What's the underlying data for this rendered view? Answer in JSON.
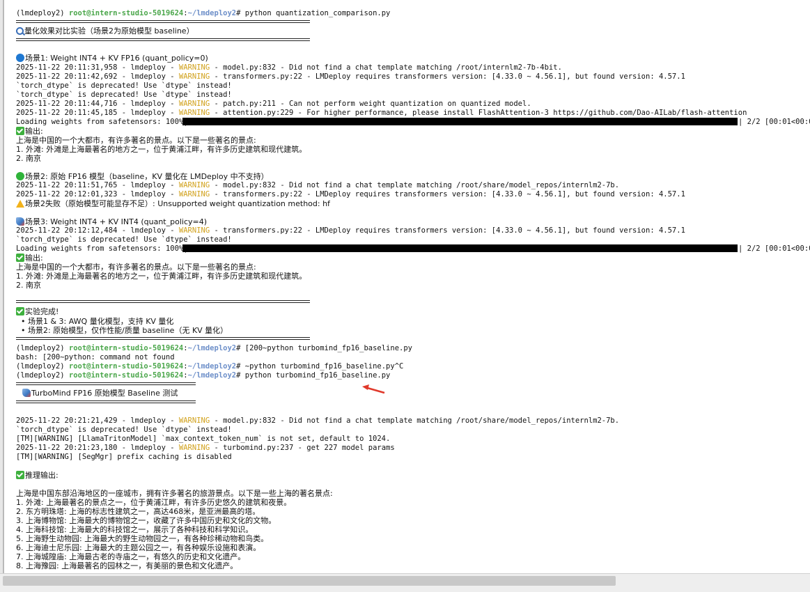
{
  "prompt": {
    "env": "(lmdeploy2)",
    "user": "root@intern-studio-5019624",
    "path": "~/lmdeploy2"
  },
  "lines": {
    "cmd1": "# python quantization_comparison.py",
    "title1": "量化效果对比实验（场景2为原始模型 baseline）",
    "s1_head": "场景1: Weight INT4 + KV FP16 (quant_policy=0)",
    "l1_pre": "2025-11-22 20:11:31,958 - lmdeploy - ",
    "l1_post": " - model.py:832 - Did not find a chat template matching /root/internlm2-7b-4bit.",
    "l2_pre": "2025-11-22 20:11:42,692 - lmdeploy - ",
    "l2_post": " - transformers.py:22 - LMDeploy requires transformers version: [4.33.0 ~ 4.56.1], but found version: 4.57.1",
    "l3": "`torch_dtype` is deprecated! Use `dtype` instead!",
    "l4": "`torch_dtype` is deprecated! Use `dtype` instead!",
    "l5_pre": "2025-11-22 20:11:44,716 - lmdeploy - ",
    "l5_post": " - patch.py:211 - Can not perform weight quantization on quantized model.",
    "l6_pre": "2025-11-22 20:11:45,185 - lmdeploy - ",
    "l6_post": " - attention.py:229 - For higher performance, please install FlashAttention-3 https://github.com/Dao-AILab/flash-attention",
    "load1": "Loading weights from safetensors: 100%|",
    "load1_tail": "| 2/2 [00:01<00:00,",
    "out1_label": "输出:",
    "out1_a": "上海是中国的一个大都市，有许多著名的景点。以下是一些著名的景点:",
    "out1_b": "1. 外滩: 外滩是上海最著名的地方之一，位于黄浦江畔，有许多历史建筑和现代建筑。",
    "out1_c": "2. 南京",
    "s2_head": "场景2: 原始 FP16 模型（baseline，KV 量化在 LMDeploy 中不支持）",
    "l7_pre": "2025-11-22 20:11:51,765 - lmdeploy - ",
    "l7_post": " - model.py:832 - Did not find a chat template matching /root/share/model_repos/internlm2-7b.",
    "l8_pre": "2025-11-22 20:12:01,323 - lmdeploy - ",
    "l8_post": " - transformers.py:22 - LMDeploy requires transformers version: [4.33.0 ~ 4.56.1], but found version: 4.57.1",
    "s2_fail": "场景2失败（原始模型可能显存不足）: Unsupported weight quantization method: hf",
    "s3_head": "场景3: Weight INT4 + KV INT4 (quant_policy=4)",
    "l9_pre": "2025-11-22 20:12:12,484 - lmdeploy - ",
    "l9_post": " - transformers.py:22 - LMDeploy requires transformers version: [4.33.0 ~ 4.56.1], but found version: 4.57.1",
    "l10": "`torch_dtype` is deprecated! Use `dtype` instead!",
    "load2": "Loading weights from safetensors: 100%|",
    "load2_tail": "| 2/2 [00:01<00:00,",
    "out2_label": "输出:",
    "out2_a": "上海是中国的一个大都市，有许多著名的景点。以下是一些著名的景点:",
    "out2_b": "1. 外滩: 外滩是上海最著名的地方之一，位于黄浦江畔，有许多历史建筑和现代建筑。",
    "out2_c": "2. 南京",
    "done": "实验完成!",
    "done_a": "  • 场景1 & 3: AWQ 量化模型，支持 KV 量化",
    "done_b": "  • 场景2: 原始模型，仅作性能/质量 baseline（无 KV 量化）",
    "cmd2": "# [200~python turbomind_fp16_baseline.py",
    "bash_err": "bash: [200~python: command not found",
    "cmd3": "# ~python turbomind_fp16_baseline.py^C",
    "cmd4": "# python turbomind_fp16_baseline.py",
    "title2": "TurboMind FP16 原始模型 Baseline 测试",
    "l11_pre": "2025-11-22 20:21:21,429 - lmdeploy - ",
    "l11_post": " - model.py:832 - Did not find a chat template matching /root/share/model_repos/internlm2-7b.",
    "l12": "`torch_dtype` is deprecated! Use `dtype` instead!",
    "l13": "[TM][WARNING] [LlamaTritonModel] `max_context_token_num` is not set, default to 1024.",
    "l14_pre": "2025-11-22 20:21:23,180 - lmdeploy - ",
    "l14_post": " - turbomind.py:237 - get 227 model params",
    "l15": "[TM][WARNING] [SegMgr] prefix caching is disabled",
    "infer_label": "推理输出:",
    "r0": "上海是中国东部沿海地区的一座城市，拥有许多著名的旅游景点。以下是一些上海的著名景点:",
    "r1": "1. 外滩: 上海最著名的景点之一，位于黄浦江畔，有许多历史悠久的建筑和夜景。",
    "r2": "2. 东方明珠塔: 上海的标志性建筑之一，高达468米，是亚洲最高的塔。",
    "r3": "3. 上海博物馆: 上海最大的博物馆之一，收藏了许多中国历史和文化的文物。",
    "r4": "4. 上海科技馆: 上海最大的科技馆之一，展示了各种科技和科学知识。",
    "r5": "5. 上海野生动物园: 上海最大的野生动物园之一，有各种珍稀动物和鸟类。",
    "r6": "6. 上海迪士尼乐园: 上海最大的主题公园之一，有各种娱乐设施和表演。",
    "r7": "7. 上海城隍庙: 上海最古老的寺庙之一，有悠久的历史和文化遗产。",
    "r8": "8. 上海豫园: 上海最著名的园林之一，有美丽的景色和文化遗产。"
  },
  "warn_word": "WARNING",
  "progress": {
    "load1": 1.0,
    "load2": 1.0
  },
  "icons": [
    "search-icon",
    "blue-circle-icon",
    "check-icon",
    "green-circle-icon",
    "warning-icon",
    "rocket-icon",
    "red-arrow-icon"
  ]
}
